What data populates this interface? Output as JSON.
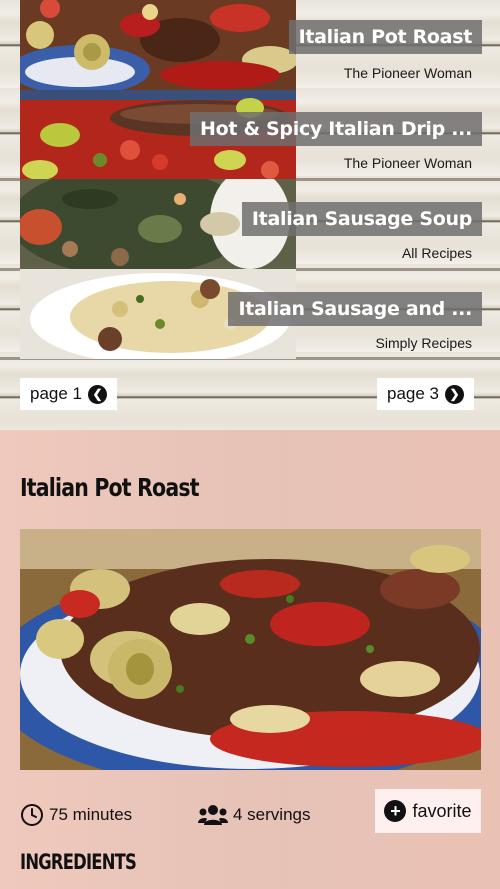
{
  "recipes": [
    {
      "title": "Italian Pot Roast",
      "source": "The Pioneer Woman"
    },
    {
      "title": "Hot & Spicy Italian Drip ...",
      "source": "The Pioneer Woman"
    },
    {
      "title": "Italian Sausage Soup",
      "source": "All Recipes"
    },
    {
      "title": "Italian Sausage and ...",
      "source": "Simply Recipes"
    }
  ],
  "pagination": {
    "prev_label": "page 1",
    "next_label": "page 3",
    "prev_icon": "chevron-left-icon",
    "next_icon": "chevron-right-icon"
  },
  "detail": {
    "title": "Italian Pot Roast",
    "time": "75 minutes",
    "servings": "4 servings",
    "favorite_label": "favorite",
    "ingredients_heading": "INGREDIENTS"
  },
  "colors": {
    "title_bg": "#6e6e6e",
    "detail_bg": "#e8c4b8",
    "favorite_bg": "#fdf0ee"
  }
}
